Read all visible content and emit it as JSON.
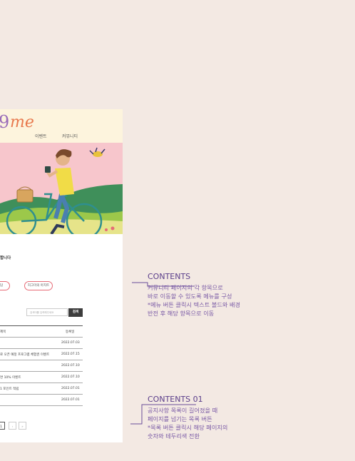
{
  "logo": {
    "digit": "9",
    "text": "me"
  },
  "nav": {
    "items": [
      "이벤트",
      "커뮤니티"
    ]
  },
  "notice": {
    "title": "합니다"
  },
  "tags": [
    "상담",
    "허그미의 아지트"
  ],
  "search": {
    "placeholder": "검색어를 입력해주세요",
    "button": "검색"
  },
  "table": {
    "headers": [
      "제목",
      "등록일"
    ],
    "rows": [
      {
        "title": "",
        "date": "2022.07.03"
      },
      {
        "title": "로 오픈 예정 프로그램 체험권 이벤트",
        "date": "2022.07.15"
      },
      {
        "title": "",
        "date": "2022.07.10"
      },
      {
        "title": "면 10% 이벤트",
        "date": "2022.07.10"
      },
      {
        "title": "1 포인트 적립",
        "date": "2022.07.01"
      },
      {
        "title": "",
        "date": "2022.07.01"
      }
    ]
  },
  "pagination": {
    "current": "1",
    "next": "›",
    "last": "»"
  },
  "notes": [
    {
      "title": "CONTENTS",
      "lines": [
        "커뮤니티 페이지의 각 항목으로",
        "바로 이동할 수 있도록 메뉴를 구성",
        "*메뉴 버튼 클릭시 텍스트 볼드와 배경",
        "반전 후 해당 항목으로 이동"
      ]
    },
    {
      "title": "CONTENTS 01",
      "lines": [
        "공지사항 목록이 길어졌을 때",
        "페이지를 넘기는 목록 버튼",
        "*목록 버튼 클릭시 해당 페이지의",
        "숫자와 테두리색 전환"
      ]
    }
  ]
}
